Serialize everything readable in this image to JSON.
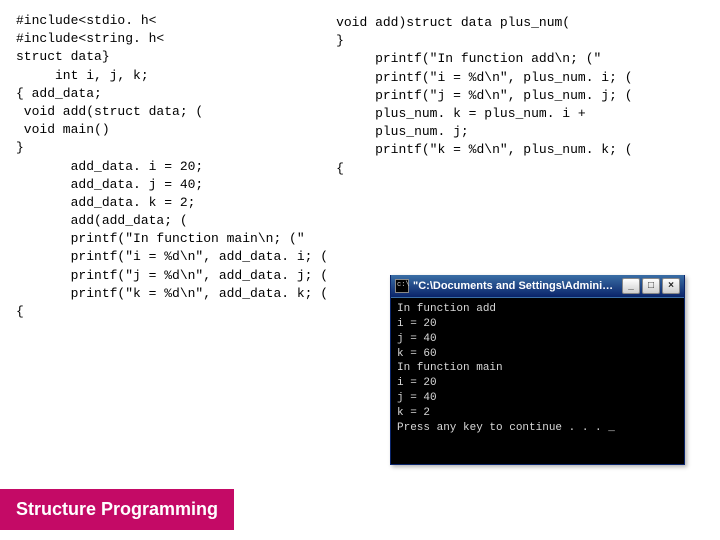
{
  "slide": {
    "left_code": "#include<stdio. h<\n#include<string. h<\nstruct data}\n     int i, j, k;\n{ add_data;\n void add(struct data; (\n void main()\n}\n       add_data. i = 20;\n       add_data. j = 40;\n       add_data. k = 2;\n       add(add_data; (\n       printf(\"In function main\\n; (\"\n       printf(\"i = %d\\n\", add_data. i; (\n       printf(\"j = %d\\n\", add_data. j; (\n       printf(\"k = %d\\n\", add_data. k; (\n{",
    "right_code": "void add)struct data plus_num(\n}\n     printf(\"In function add\\n; (\"\n     printf(\"i = %d\\n\", plus_num. i; (\n     printf(\"j = %d\\n\", plus_num. j; (\n     plus_num. k = plus_num. i +\n     plus_num. j;\n     printf(\"k = %d\\n\", plus_num. k; (\n{"
  },
  "console": {
    "title": "\"C:\\Documents and Settings\\Administra...",
    "body": "In function add\ni = 20\nj = 40\nk = 60\nIn function main\ni = 20\nj = 40\nk = 2\nPress any key to continue . . . _",
    "buttons": {
      "min": "_",
      "max": "□",
      "close": "×"
    }
  },
  "footer": {
    "label": "Structure Programming"
  }
}
